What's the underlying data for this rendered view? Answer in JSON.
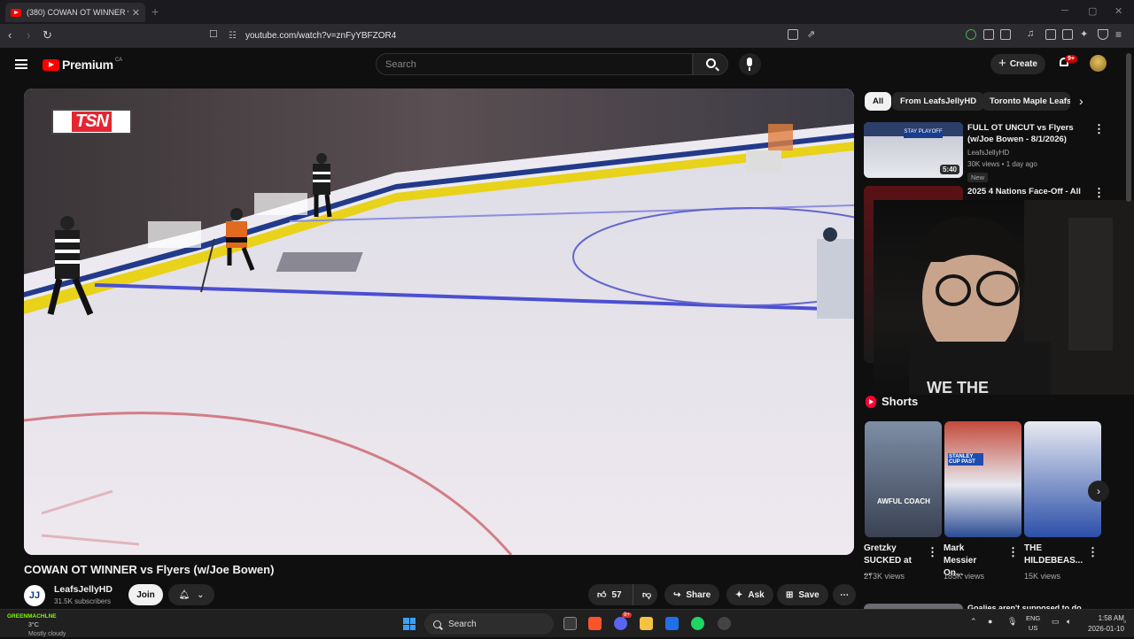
{
  "browser": {
    "tab_title": "(380) COWAN OT WINNER vs Fly",
    "url": "youtube.com/watch?v=znFyYBFZOR4"
  },
  "header": {
    "logo": "Premium",
    "country": "CA",
    "search_placeholder": "Search",
    "create_label": "Create",
    "notifications": "9+"
  },
  "video": {
    "title": "COWAN OT WINNER vs Flyers (w/Joe Bowen)",
    "overlay_logo": "TSN",
    "channel_name": "LeafsJellyHD",
    "channel_initials": "JJ",
    "subscribers": "31.5K subscribers",
    "join_label": "Join",
    "likes": "57",
    "share_label": "Share",
    "ask_label": "Ask",
    "save_label": "Save"
  },
  "chips": [
    {
      "label": "All",
      "active": true
    },
    {
      "label": "From LeafsJellyHD",
      "active": false
    },
    {
      "label": "Toronto Maple Leafs",
      "active": false
    }
  ],
  "recommendations": [
    {
      "title": "FULL OT UNCUT vs Flyers (w/Joe Bowen - 8/1/2026)",
      "channel": "LeafsJellyHD",
      "meta": "30K views • 1 day ago",
      "badge": "New",
      "duration": "5:40"
    },
    {
      "title": "2025 4 Nations Face-Off - All"
    }
  ],
  "shorts": {
    "heading": "Shorts",
    "items": [
      {
        "title": "Gretzky SUCKED at ...",
        "views": "273K views",
        "caption": "AWFUL COACH"
      },
      {
        "title": "Mark Messier On...",
        "views": "185K views",
        "caption": "STANLEY CUP PAST"
      },
      {
        "title": "THE HILDEBEAS...",
        "views": "15K views",
        "caption": ""
      }
    ]
  },
  "next_item_partial": "Goalies aren't supposed to do",
  "taskbar": {
    "weather_user": "GREENMACHLNE",
    "temp": "3°C",
    "condition": "Mostly cloudy",
    "search_label": "Search",
    "lang1": "ENG",
    "lang2": "US",
    "time": "1:58 AM",
    "date": "2026-01-10",
    "discord_badge": "9+"
  }
}
